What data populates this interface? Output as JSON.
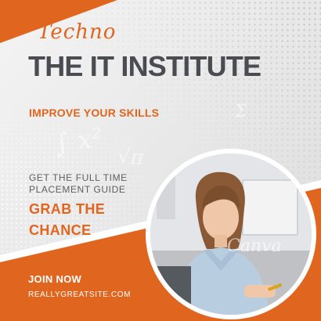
{
  "brand": {
    "script": "Techno"
  },
  "title": "THE IT INSTITUTE",
  "tagline": "IMPROVE YOUR SKILLS",
  "guide_line": "GET THE FULL TIME PLACEMENT GUIDE",
  "cta": "GRAB THE CHANCE",
  "join": "JOIN NOW",
  "website": "REALLYGREATSITE.COM",
  "watermark": "Canva",
  "colors": {
    "accent": "#e0651f",
    "title": "#4a4c52",
    "background": "#ececec"
  }
}
